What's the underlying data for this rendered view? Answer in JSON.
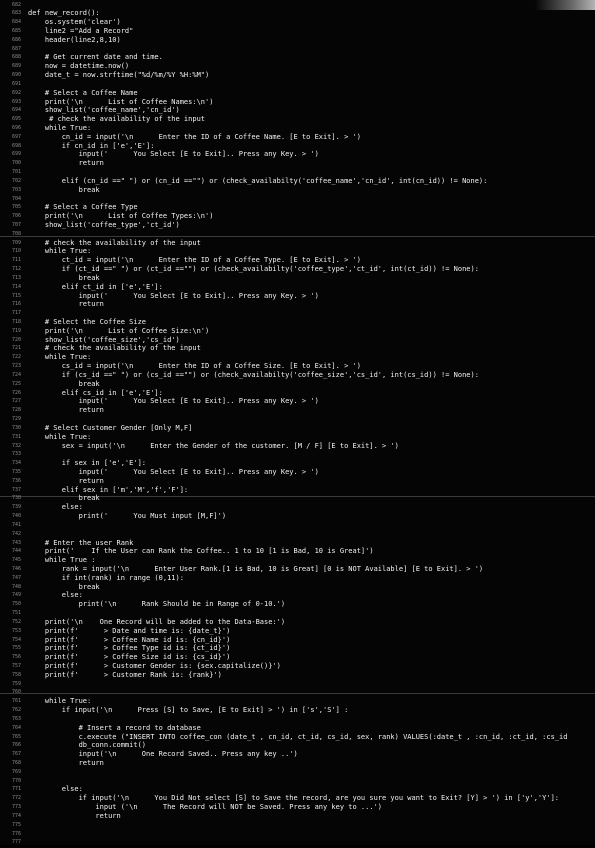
{
  "editor": {
    "lines": [
      {
        "n": "682",
        "t": ""
      },
      {
        "n": "683",
        "t": "def new_record():"
      },
      {
        "n": "684",
        "t": "    os.system('clear')"
      },
      {
        "n": "685",
        "t": "    line2 =\"Add a Record\""
      },
      {
        "n": "686",
        "t": "    header(line2,8,10)"
      },
      {
        "n": "687",
        "t": ""
      },
      {
        "n": "688",
        "t": "    # Get current date and time."
      },
      {
        "n": "689",
        "t": "    now = datetime.now()"
      },
      {
        "n": "690",
        "t": "    date_t = now.strftime(\"%d/%m/%Y %H:%M\")"
      },
      {
        "n": "691",
        "t": ""
      },
      {
        "n": "692",
        "t": "    # Select a Coffee Name"
      },
      {
        "n": "693",
        "t": "    print('\\n      List of Coffee Names:\\n')"
      },
      {
        "n": "694",
        "t": "    show_list('coffee_name','cn_id')"
      },
      {
        "n": "695",
        "t": "     # check the availability of the input"
      },
      {
        "n": "696",
        "t": "    while True:"
      },
      {
        "n": "697",
        "t": "        cn_id = input('\\n      Enter the ID of a Coffee Name. [E to Exit]. > ')"
      },
      {
        "n": "698",
        "t": "        if cn_id in ['e','E']:"
      },
      {
        "n": "699",
        "t": "            input('      You Select [E to Exit].. Press any Key. > ')"
      },
      {
        "n": "700",
        "t": "            return"
      },
      {
        "n": "701",
        "t": ""
      },
      {
        "n": "702",
        "t": "        elif (cn_id ==\" \") or (cn_id ==\"\") or (check_availabilty('coffee_name','cn_id', int(cn_id)) != None):"
      },
      {
        "n": "703",
        "t": "            break"
      },
      {
        "n": "704",
        "t": ""
      },
      {
        "n": "705",
        "t": "    # Select a Coffee Type"
      },
      {
        "n": "706",
        "t": "    print('\\n      List of Coffee Types:\\n')"
      },
      {
        "n": "707",
        "t": "    show_list('coffee_type','ct_id')"
      },
      {
        "n": "708",
        "t": ""
      },
      {
        "n": "709",
        "t": "    # check the availability of the input"
      },
      {
        "n": "710",
        "t": "    while True:"
      },
      {
        "n": "711",
        "t": "        ct_id = input('\\n      Enter the ID of a Coffee Type. [E to Exit]. > ')"
      },
      {
        "n": "712",
        "t": "        if (ct_id ==\" \") or (ct_id ==\"\") or (check_availabilty('coffee_type','ct_id', int(ct_id)) != None):"
      },
      {
        "n": "713",
        "t": "            break"
      },
      {
        "n": "714",
        "t": "        elif ct_id in ['e','E']:"
      },
      {
        "n": "715",
        "t": "            input('      You Select [E to Exit].. Press any Key. > ')"
      },
      {
        "n": "716",
        "t": "            return"
      },
      {
        "n": "717",
        "t": ""
      },
      {
        "n": "718",
        "t": "    # Select the Coffee Size"
      },
      {
        "n": "719",
        "t": "    print('\\n      List of Coffee Size:\\n')"
      },
      {
        "n": "720",
        "t": "    show_list('coffee_size','cs_id')"
      },
      {
        "n": "721",
        "t": "    # check the availability of the input"
      },
      {
        "n": "722",
        "t": "    while True:"
      },
      {
        "n": "723",
        "t": "        cs_id = input('\\n      Enter the ID of a Coffee Size. [E to Exit]. > ')"
      },
      {
        "n": "724",
        "t": "        if (cs_id ==\" \") or (cs_id ==\"\") or (check_availabilty('coffee_size','cs_id', int(cs_id)) != None):"
      },
      {
        "n": "725",
        "t": "            break"
      },
      {
        "n": "726",
        "t": "        elif cs_id in ['e','E']:"
      },
      {
        "n": "727",
        "t": "            input('      You Select [E to Exit].. Press any Key. > ')"
      },
      {
        "n": "728",
        "t": "            return"
      },
      {
        "n": "729",
        "t": ""
      },
      {
        "n": "730",
        "t": "    # Select Customer Gender [Only M,F]"
      },
      {
        "n": "731",
        "t": "    while True:"
      },
      {
        "n": "732",
        "t": "        sex = input('\\n      Enter the Gender of the customer. [M / F] [E to Exit]. > ')"
      },
      {
        "n": "733",
        "t": ""
      },
      {
        "n": "734",
        "t": "        if sex in ['e','E']:"
      },
      {
        "n": "735",
        "t": "            input('      You Select [E to Exit].. Press any Key. > ')"
      },
      {
        "n": "736",
        "t": "            return"
      },
      {
        "n": "737",
        "t": "        elif sex in ['m','M','f','F']:"
      },
      {
        "n": "738",
        "t": "            break"
      },
      {
        "n": "739",
        "t": "        else:"
      },
      {
        "n": "740",
        "t": "            print('      You Must input [M,F]')"
      },
      {
        "n": "741",
        "t": ""
      },
      {
        "n": "742",
        "t": ""
      },
      {
        "n": "743",
        "t": "    # Enter the user Rank"
      },
      {
        "n": "744",
        "t": "    print('    If the User can Rank the Coffee.. 1 to 10 [1 is Bad, 10 is Great]')"
      },
      {
        "n": "745",
        "t": "    while True :"
      },
      {
        "n": "746",
        "t": "        rank = input('\\n      Enter User Rank.[1 is Bad, 10 is Great] [0 is NOT Available] [E to Exit]. > ')"
      },
      {
        "n": "747",
        "t": "        if int(rank) in range (0,11):"
      },
      {
        "n": "748",
        "t": "            break"
      },
      {
        "n": "749",
        "t": "        else:"
      },
      {
        "n": "750",
        "t": "            print('\\n      Rank Should be in Range of 0-10.')"
      },
      {
        "n": "751",
        "t": ""
      },
      {
        "n": "752",
        "t": "    print('\\n    One Record will be added to the Data-Base:')"
      },
      {
        "n": "753",
        "t": "    print(f'      > Date and time is: {date_t}')"
      },
      {
        "n": "754",
        "t": "    print(f'      > Coffee Name id is: {cn_id}')"
      },
      {
        "n": "755",
        "t": "    print(f'      > Coffee Type id is: {ct_id}')"
      },
      {
        "n": "756",
        "t": "    print(f'      > Coffee Size id is: {cs_id}')"
      },
      {
        "n": "757",
        "t": "    print(f'      > Customer Gender is: {sex.capitalize()}')"
      },
      {
        "n": "758",
        "t": "    print(f'      > Customer Rank is: {rank}')"
      },
      {
        "n": "759",
        "t": ""
      },
      {
        "n": "760",
        "t": ""
      },
      {
        "n": "761",
        "t": "    while True:"
      },
      {
        "n": "762",
        "t": "        if input('\\n      Press [S] to Save, [E to Exit] > ') in ['s','S'] :"
      },
      {
        "n": "763",
        "t": ""
      },
      {
        "n": "764",
        "t": "            # Insert a record to database"
      },
      {
        "n": "765",
        "t": "            c.execute (\"INSERT INTO coffee_con (date_t , cn_id, ct_id, cs_id, sex, rank) VALUES(:date_t , :cn_id, :ct_id, :cs_id"
      },
      {
        "n": "766",
        "t": "            db_conn.commit()"
      },
      {
        "n": "767",
        "t": "            input('\\n      One Record Saved.. Press any key ..')"
      },
      {
        "n": "768",
        "t": "            return"
      },
      {
        "n": "769",
        "t": ""
      },
      {
        "n": "770",
        "t": ""
      },
      {
        "n": "771",
        "t": "        else:"
      },
      {
        "n": "772",
        "t": "            if input('\\n      You Did Not select [S] to Save the record, are you sure you want to Exit? [Y] > ') in ['y','Y']:"
      },
      {
        "n": "773",
        "t": "                input ('\\n      The Record will NOT be Saved. Press any key to ...')"
      },
      {
        "n": "774",
        "t": "                return"
      },
      {
        "n": "775",
        "t": ""
      },
      {
        "n": "776",
        "t": ""
      },
      {
        "n": "777",
        "t": ""
      }
    ]
  }
}
